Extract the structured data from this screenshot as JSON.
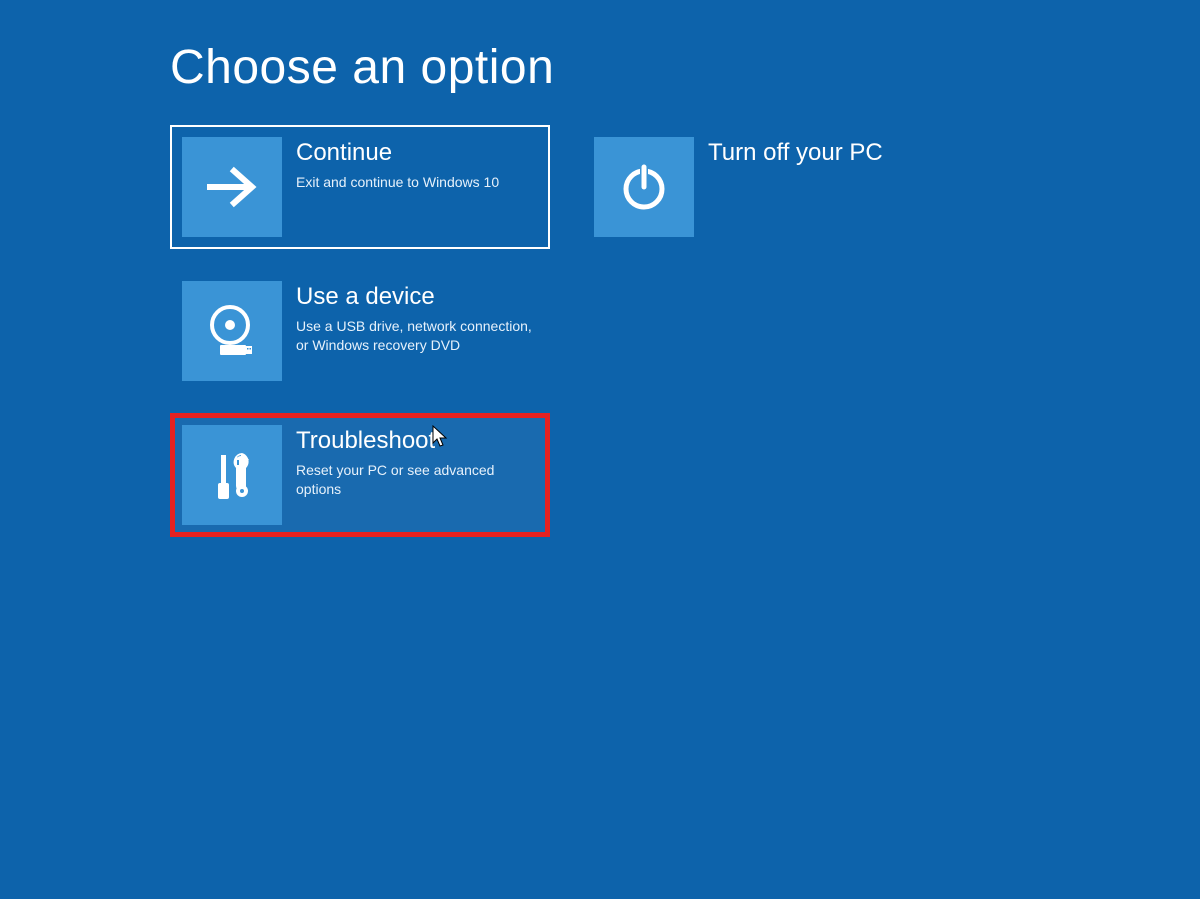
{
  "title": "Choose an option",
  "options": {
    "continue": {
      "title": "Continue",
      "desc": "Exit and continue to Windows 10"
    },
    "use_device": {
      "title": "Use a device",
      "desc": "Use a USB drive, network connection, or Windows recovery DVD"
    },
    "troubleshoot": {
      "title": "Troubleshoot",
      "desc": "Reset your PC or see advanced options"
    },
    "turn_off": {
      "title": "Turn off your PC",
      "desc": ""
    }
  },
  "colors": {
    "background": "#0d63ab",
    "tile_icon_bg": "#3a94d6",
    "highlight_border": "#e62121"
  }
}
